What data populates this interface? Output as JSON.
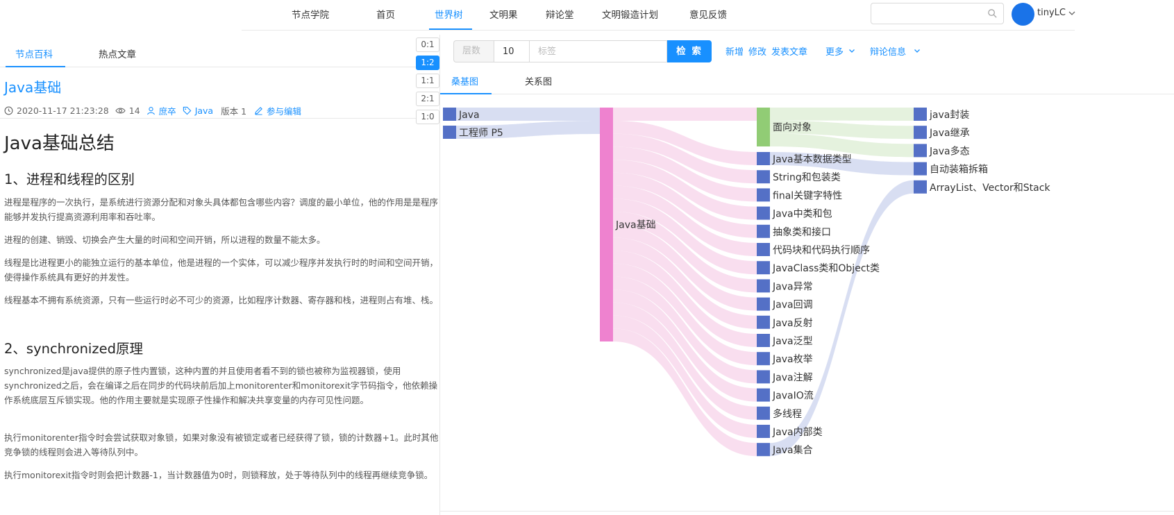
{
  "topnav": {
    "brand": "节点学院",
    "items": [
      {
        "label": "首页",
        "active": false
      },
      {
        "label": "世界树",
        "active": true
      },
      {
        "label": "文明果",
        "active": false
      },
      {
        "label": "辩论堂",
        "active": false
      },
      {
        "label": "文明锻造计划",
        "active": false
      },
      {
        "label": "意见反馈",
        "active": false
      }
    ],
    "search": {
      "placeholder": "",
      "value": ""
    },
    "username": "tinyLC"
  },
  "left": {
    "tabs": [
      {
        "label": "节点百科",
        "active": true
      },
      {
        "label": "热点文章",
        "active": false
      }
    ],
    "article": {
      "title": "Java基础",
      "datetime": "2020-11-17 21:23:28",
      "views": "14",
      "author": "庶卒",
      "tag": "Java",
      "version": "版本 1",
      "edit": "参与编辑",
      "h1": "Java基础总结",
      "sections": [
        {
          "heading": "1、进程和线程的区别",
          "paragraphs": [
            "进程是程序的一次执行，是系统进行资源分配和对象头具体都包含哪些内容？调度的最小单位，他的作用是是程序能够并发执行提高资源利用率和吞吐率。",
            "进程的创建、销毁、切换会产生大量的时间和空间开销，所以进程的数量不能太多。",
            "线程是比进程更小的能独立运行的基本单位，他是进程的一个实体，可以减少程序并发执行时的时间和空间开销，使得操作系统具有更好的并发性。",
            "线程基本不拥有系统资源，只有一些运行时必不可少的资源，比如程序计数器、寄存器和栈，进程则占有堆、栈。"
          ]
        },
        {
          "heading": "2、synchronized原理",
          "paragraphs": [
            "synchronized是java提供的原子性内置锁，这种内置的并且使用者看不到的锁也被称为监视器锁，使用synchronized之后，会在编译之后在同步的代码块前后加上monitorenter和monitorexit字节码指令，他依赖操作系统底层互斥锁实现。他的作用主要就是实现原子性操作和解决共享变量的内存可见性问题。",
            "执行monitorenter指令时会尝试获取对象锁，如果对象没有被锁定或者已经获得了锁，锁的计数器+1。此时其他竞争锁的线程则会进入等待队列中。",
            "执行monitorexit指令时则会把计数器-1，当计数器值为0时，则锁释放，处于等待队列中的线程再继续竞争锁。"
          ]
        }
      ]
    }
  },
  "ratios": [
    {
      "label": "0:1",
      "active": false
    },
    {
      "label": "1:2",
      "active": true
    },
    {
      "label": "1:1",
      "active": false
    },
    {
      "label": "2:1",
      "active": false
    },
    {
      "label": "1:0",
      "active": false
    }
  ],
  "toolbar": {
    "layer_label": "层数",
    "layer_value": "10",
    "tag_placeholder": "标签",
    "search_button": "检 索",
    "links": [
      "新增",
      "修改",
      "发表文章"
    ],
    "more": "更多",
    "debate": "辩论信息"
  },
  "graph_tabs": [
    {
      "label": "桑基图",
      "active": true
    },
    {
      "label": "关系图",
      "active": false
    }
  ],
  "sankey": {
    "colors": {
      "source": "#5470c6",
      "hub": "#ee82cf",
      "oop": "#91cc75",
      "link_blue": "#d6dcf1",
      "link_pink": "#f9dcee",
      "link_green": "#e4f1dc"
    },
    "sources": [
      "Java",
      "工程师 P5"
    ],
    "hub": "Java基础",
    "oop": "面向对象",
    "middle": [
      "Java基本数据类型",
      "String和包装类",
      "final关键字特性",
      "Java中类和包",
      "抽象类和接口",
      "代码块和代码执行顺序",
      "JavaClass类和Object类",
      "Java异常",
      "Java回调",
      "Java反射",
      "Java泛型",
      "Java枚举",
      "Java注解",
      "JavaIO流",
      "多线程",
      "Java内部类",
      "Java集合"
    ],
    "right": [
      "java封装",
      "Java继承",
      "Java多态",
      "自动装箱拆箱",
      "ArrayList、Vector和Stack"
    ]
  }
}
